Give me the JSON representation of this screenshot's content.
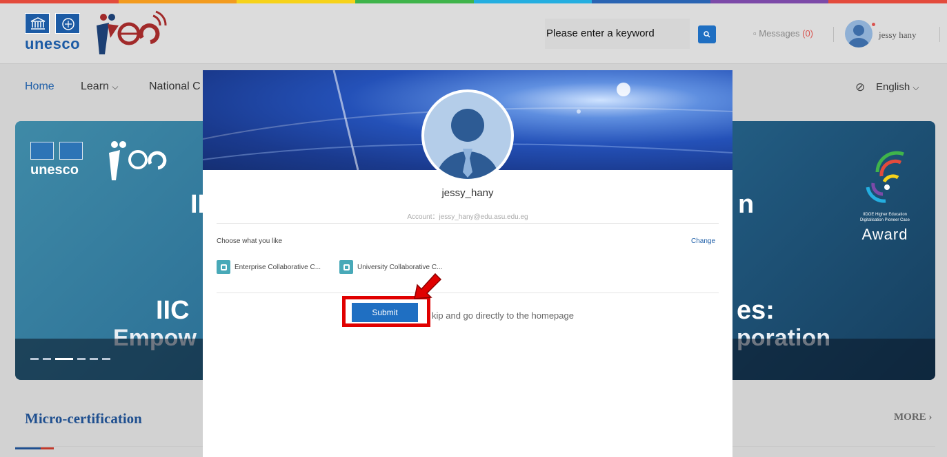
{
  "colors": {
    "stripe": [
      "#e34b3c",
      "#f29b1f",
      "#f6d21a",
      "#3fb44b",
      "#24aee0",
      "#2a64b3",
      "#7c4aa8",
      "#e34b3c"
    ],
    "accent_blue": "#1f6fc2",
    "highlight_red": "#e00000"
  },
  "header": {
    "logo_text": "unesco",
    "search_placeholder": "Please enter a keyword",
    "search_icon": "search-icon",
    "messages_label": "Messages",
    "messages_count": "(0)",
    "username": "jessy hany"
  },
  "nav": {
    "items": [
      "Home",
      "Learn",
      "National C"
    ],
    "language": "English"
  },
  "banner": {
    "logo_text": "unesco",
    "line1_left": "II",
    "line1_right": "n",
    "line2_left": "IIC",
    "line2_right": "es:",
    "line3_left": "Empow",
    "line3_right": "poration",
    "award_small": "IIDOE Higher Education\nDigitalisation Pioneer Case",
    "award_big": "Award"
  },
  "section": {
    "title": "Micro-certification",
    "more": "MORE ›"
  },
  "modal": {
    "name": "jessy_hany",
    "account": "Account：jessy_hany@edu.asu.edu.eg",
    "choose_label": "Choose what you like",
    "change_label": "Change",
    "tags": [
      "Enterprise Collaborative C...",
      "University Collaborative C..."
    ],
    "submit_label": "Submit",
    "skip_label": "kip and go directly to the homepage"
  }
}
